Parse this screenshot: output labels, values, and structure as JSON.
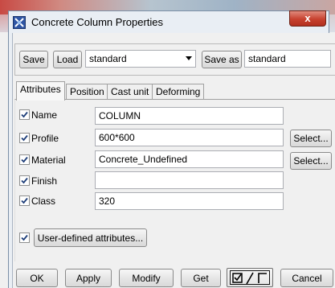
{
  "window": {
    "title": "Concrete Column Properties",
    "close_symbol": "x",
    "icon": "tekla-app-icon"
  },
  "toolbar": {
    "save_label": "Save",
    "load_label": "Load",
    "load_combo_value": "standard",
    "save_as_label": "Save as",
    "save_as_value": "standard"
  },
  "tabs": [
    {
      "label": "Attributes",
      "active": true
    },
    {
      "label": "Position",
      "active": false
    },
    {
      "label": "Cast unit",
      "active": false
    },
    {
      "label": "Deforming",
      "active": false
    }
  ],
  "attributes": {
    "name": {
      "label": "Name",
      "value": "COLUMN",
      "checked": true
    },
    "profile": {
      "label": "Profile",
      "value": "600*600",
      "checked": true,
      "button": "Select..."
    },
    "material": {
      "label": "Material",
      "value": "Concrete_Undefined",
      "checked": true,
      "button": "Select..."
    },
    "finish": {
      "label": "Finish",
      "value": "",
      "checked": true
    },
    "class": {
      "label": "Class",
      "value": "320",
      "checked": true
    }
  },
  "udas": {
    "checked": true,
    "button_label": "User-defined attributes..."
  },
  "footer": {
    "ok_label": "OK",
    "apply_label": "Apply",
    "modify_label": "Modify",
    "get_label": "Get",
    "toggle_label": "☑/☐",
    "cancel_label": "Cancel"
  },
  "colors": {
    "checkmark": "#1f3f7a",
    "close_button": "#c7412f",
    "title_icon": "#2f55a4"
  }
}
